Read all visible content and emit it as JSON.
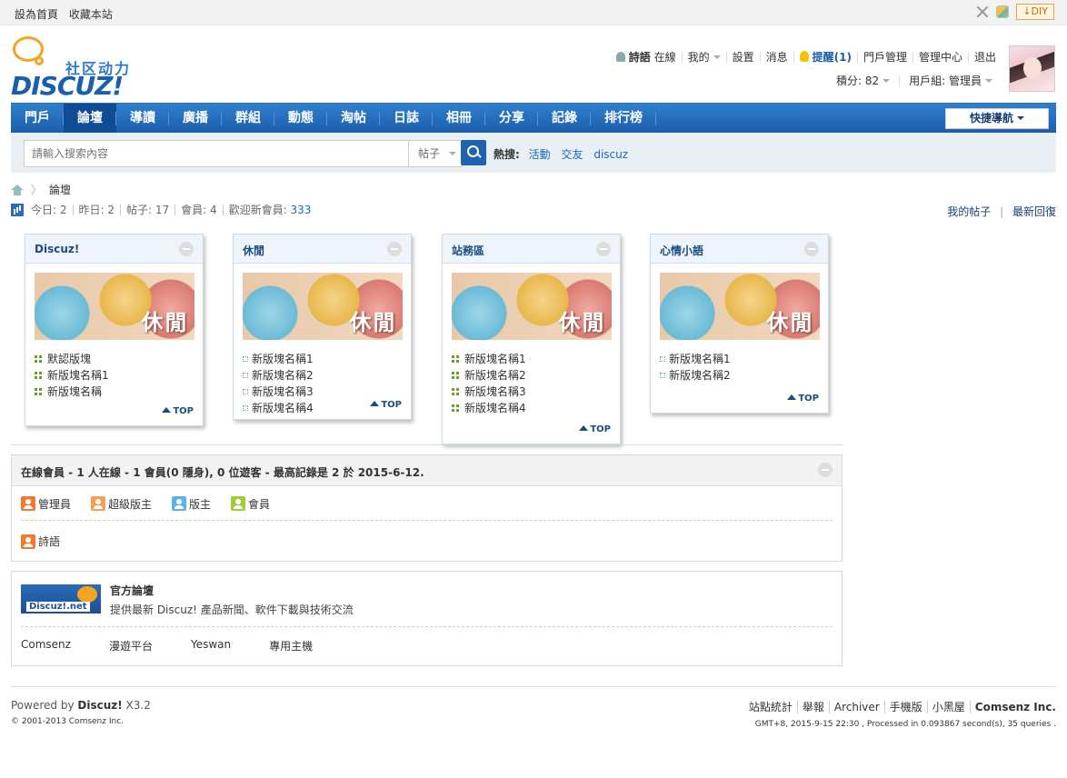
{
  "topbar": {
    "set_home": "設為首頁",
    "bookmark": "收藏本站",
    "diy": "↓DIY"
  },
  "logo": {
    "cn": "社区动力",
    "en": "DISCUZ!"
  },
  "user": {
    "name": "詩語",
    "status": "在線",
    "mine": "我的",
    "settings": "設置",
    "messages": "消息",
    "remind": "提醒(1)",
    "portal_manage": "門戶管理",
    "admin_center": "管理中心",
    "logout": "退出",
    "points": "積分: 82",
    "group": "用戶組: 管理員"
  },
  "nav": {
    "items": [
      "門戶",
      "論壇",
      "導讀",
      "廣播",
      "群組",
      "動態",
      "淘帖",
      "日誌",
      "相冊",
      "分享",
      "記錄",
      "排行榜"
    ],
    "active": 1,
    "quick_nav": "快捷導航"
  },
  "search": {
    "placeholder": "請輸入搜索內容",
    "type": "帖子",
    "hot_label": "熱搜:",
    "hot": [
      "活動",
      "交友",
      "discuz"
    ]
  },
  "breadcrumb": {
    "current": "論壇"
  },
  "stats": {
    "today": "今日: 2",
    "yesterday": "昨日: 2",
    "posts": "帖子: 17",
    "members": "會員: 4",
    "welcome_label": "歡迎新會員: ",
    "welcome_user": "333",
    "my_posts": "我的帖子",
    "latest": "最新回復"
  },
  "forums": [
    {
      "name": "Discuz!",
      "image_label": "休閒",
      "boards": [
        "默認版塊",
        "新版塊名稱1",
        "新版塊名稱"
      ],
      "top": "TOP"
    },
    {
      "name": "休閒",
      "image_label": "休閒",
      "boards": [
        "新版塊名稱1",
        "新版塊名稱2",
        "新版塊名稱3",
        "新版塊名稱4"
      ],
      "top": "TOP"
    },
    {
      "name": "站務區",
      "image_label": "休閒",
      "boards": [
        "新版塊名稱1",
        "新版塊名稱2",
        "新版塊名稱3",
        "新版塊名稱4"
      ],
      "top": "TOP"
    },
    {
      "name": "心情小語",
      "image_label": "休閒",
      "boards": [
        "新版塊名稱1",
        "新版塊名稱2"
      ],
      "top": "TOP"
    }
  ],
  "online": {
    "title": "在線會員 - 1 人在線 - 1 會員(0 隱身), 0 位遊客 - 最高記錄是 2 於 2015-6-12.",
    "legend": [
      "管理員",
      "超級版主",
      "版主",
      "會員"
    ],
    "users": [
      "詩語"
    ]
  },
  "links": {
    "logo_text": "Discuz!.net",
    "title": "官方論壇",
    "desc": "提供最新 Discuz! 產品新聞、軟件下載與技術交流",
    "partners": [
      "Comsenz",
      "漫遊平台",
      "Yeswan",
      "專用主機"
    ]
  },
  "footer": {
    "powered": "Powered by ",
    "brand": "Discuz!",
    "version": " X3.2",
    "copyright": "© 2001-2013 Comsenz Inc.",
    "links": [
      "站點統計",
      "舉報",
      "Archiver",
      "手機版",
      "小黑屋"
    ],
    "company": "Comsenz Inc.",
    "meta": "GMT+8, 2015-9-15 22:30 , Processed in 0.093867 second(s), 35 queries ."
  }
}
